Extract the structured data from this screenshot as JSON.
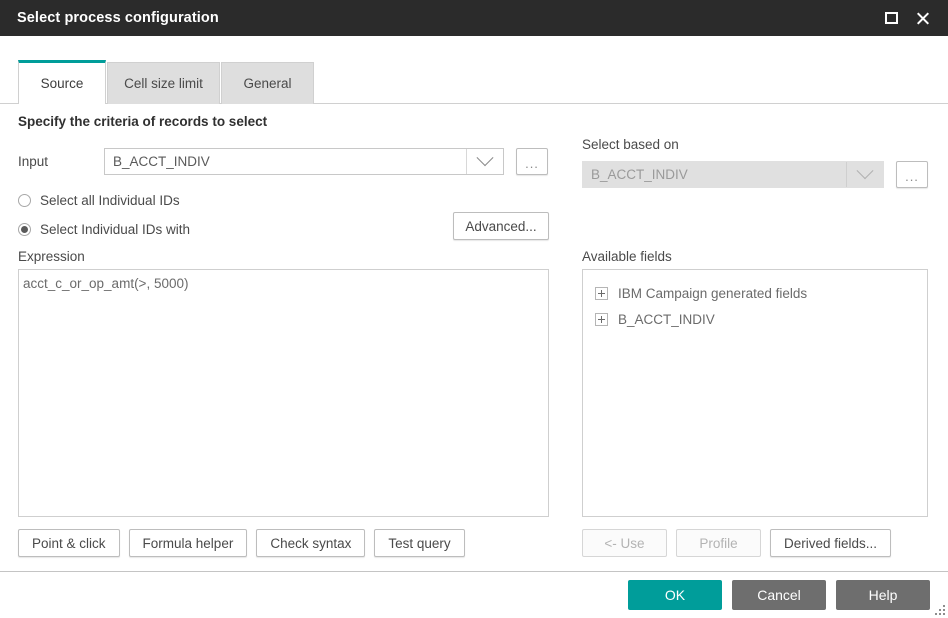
{
  "window": {
    "title": "Select process configuration",
    "controls": {
      "maximize": "maximize-icon",
      "close": "close-icon"
    }
  },
  "tabs": [
    {
      "label": "Source",
      "active": true
    },
    {
      "label": "Cell size limit",
      "active": false
    },
    {
      "label": "General",
      "active": false
    }
  ],
  "source_tab": {
    "heading": "Specify the criteria of records to select",
    "input": {
      "label": "Input",
      "value": "B_ACCT_INDIV",
      "browse_label": "...",
      "disabled": false
    },
    "radios": [
      {
        "label": "Select all Individual IDs",
        "selected": false
      },
      {
        "label": "Select Individual IDs with",
        "selected": true
      }
    ],
    "advanced_label": "Advanced...",
    "expression": {
      "label": "Expression",
      "value": "acct_c_or_op_amt(>, 5000)"
    },
    "expression_buttons": [
      {
        "label": "Point & click",
        "disabled": false
      },
      {
        "label": "Formula helper",
        "disabled": false
      },
      {
        "label": "Check syntax",
        "disabled": false
      },
      {
        "label": "Test query",
        "disabled": false
      }
    ],
    "select_based_on": {
      "label": "Select based on",
      "value": "B_ACCT_INDIV",
      "browse_label": "...",
      "disabled": true
    },
    "available_fields": {
      "label": "Available fields",
      "items": [
        {
          "label": "IBM Campaign generated fields",
          "expanded": false
        },
        {
          "label": "B_ACCT_INDIV",
          "expanded": false
        }
      ]
    },
    "field_buttons": [
      {
        "label": "<- Use",
        "disabled": true
      },
      {
        "label": "Profile",
        "disabled": true
      },
      {
        "label": "Derived fields...",
        "disabled": false
      }
    ]
  },
  "footer": {
    "ok_label": "OK",
    "cancel_label": "Cancel",
    "help_label": "Help"
  },
  "colors": {
    "accent_teal": "#009d9a",
    "titlebar": "#2b2b2b",
    "footer_grey": "#6e6e6e",
    "tab_inactive": "#dedede"
  }
}
